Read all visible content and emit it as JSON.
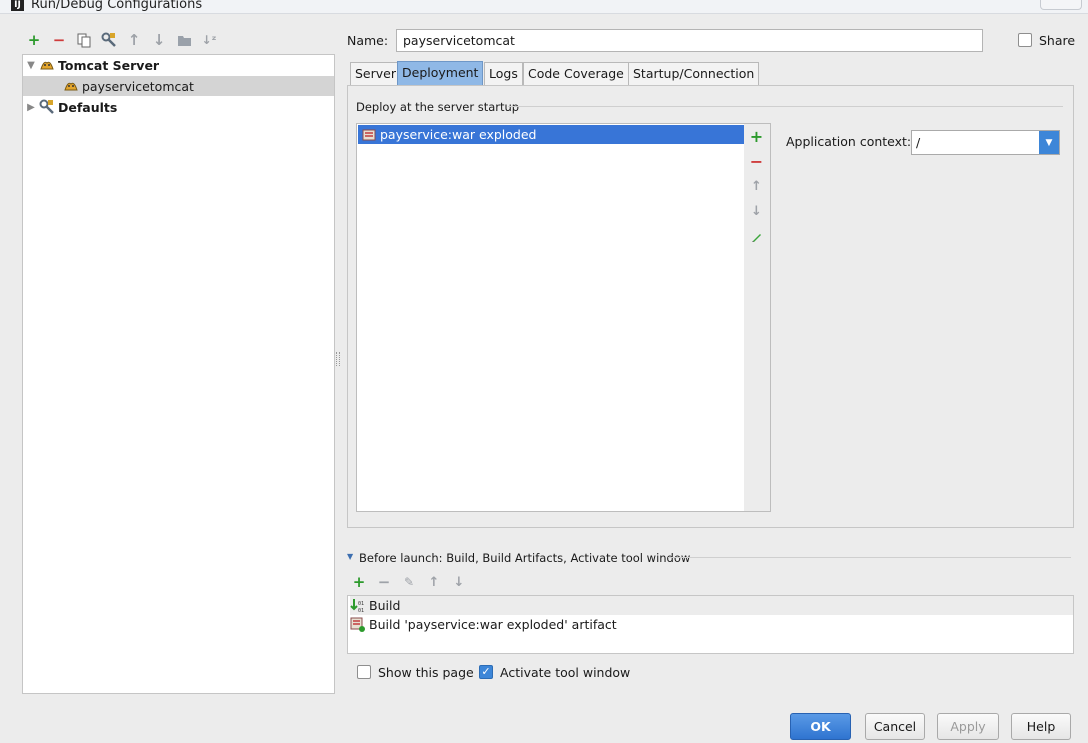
{
  "window": {
    "title": "Run/Debug Configurations"
  },
  "toolbar": {
    "icons": [
      "add-icon",
      "remove-icon",
      "copy-icon",
      "edit-defaults-icon",
      "move-up-icon",
      "move-down-icon",
      "folder-icon",
      "sort-icon"
    ]
  },
  "tree": {
    "server_group": "Tomcat Server",
    "config_item": "payservicetomcat",
    "defaults": "Defaults"
  },
  "name": {
    "label": "Name:",
    "value": "payservicetomcat"
  },
  "share": {
    "label": "Share",
    "checked": false
  },
  "tabs": [
    {
      "label": "Server",
      "active": false
    },
    {
      "label": "Deployment",
      "active": true
    },
    {
      "label": "Logs",
      "active": false
    },
    {
      "label": "Code Coverage",
      "active": false
    },
    {
      "label": "Startup/Connection",
      "active": false
    }
  ],
  "deployment": {
    "group_title": "Deploy at the server startup",
    "items": [
      "payservice:war exploded"
    ],
    "context_label": "Application context:",
    "context_value": "/"
  },
  "before_launch": {
    "title": "Before launch: Build, Build Artifacts, Activate tool window",
    "items": [
      "Build",
      "Build 'payservice:war exploded' artifact"
    ]
  },
  "options": {
    "show_page": {
      "label": "Show this page",
      "checked": false
    },
    "activate_tool_window": {
      "label": "Activate tool window",
      "checked": true
    }
  },
  "buttons": {
    "ok": "OK",
    "cancel": "Cancel",
    "apply": "Apply",
    "help": "Help"
  },
  "colors": {
    "selection": "#3875d7",
    "active_tab": "#8fb8e6",
    "add": "#2c9a2c",
    "remove": "#cf3b3b"
  }
}
